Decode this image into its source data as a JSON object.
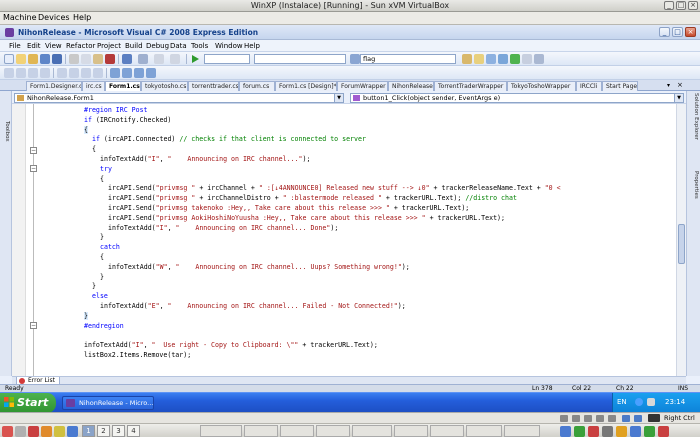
{
  "host": {
    "title": "WinXP (Instalace) [Running] - Sun xVM VirtualBox",
    "menu": [
      "Machine",
      "Devices",
      "Help"
    ],
    "hostkey": "Right Ctrl",
    "panel_numbers": [
      "2",
      "3",
      "4"
    ],
    "panel_active": "1"
  },
  "vs": {
    "title": "NihonRelease - Microsoft Visual C# 2008 Express Edition",
    "menu": [
      "File",
      "Edit",
      "View",
      "Refactor",
      "Project",
      "Build",
      "Debug",
      "Data",
      "Tools",
      "Window",
      "Help"
    ],
    "toolbar_search": "flag",
    "tabs": [
      "Form1.Designer.cs",
      "irc.cs",
      "Form1.cs*",
      "tokyotosho.cs",
      "torrenttrader.cs",
      "forum.cs",
      "Form1.cs [Design]*",
      "ForumWrapper",
      "NihonRelease",
      "TorrentTraderWrapper",
      "TokyoToshoWrapper",
      "IRCCli",
      "Start Page"
    ],
    "active_tab_index": 2,
    "class_combo": "NihonRelease.Form1",
    "member_combo": "button1_Click(object sender, EventArgs e)",
    "left_strip": "Toolbox",
    "right_strip_top": "Solution Explorer",
    "right_strip_bottom": "Properties",
    "error_list": "Error List",
    "status": {
      "ready": "Ready",
      "ln": "Ln 378",
      "col": "Col 22",
      "ch": "Ch 22",
      "ins": "INS"
    }
  },
  "code": [
    {
      "indent": 12,
      "parts": [
        {
          "t": "#region IRC Post",
          "c": "kw"
        }
      ]
    },
    {
      "indent": 12,
      "parts": [
        {
          "t": "if",
          "c": "kw"
        },
        {
          "t": " (IRCnotify.Checked)",
          "c": ""
        }
      ]
    },
    {
      "indent": 12,
      "parts": [
        {
          "t": "{",
          "c": "hl"
        }
      ]
    },
    {
      "indent": 14,
      "parts": [
        {
          "t": "if",
          "c": "kw"
        },
        {
          "t": " (ircAPI.Connected) ",
          "c": ""
        },
        {
          "t": "// checks if that client is connected to server",
          "c": "cm"
        }
      ]
    },
    {
      "indent": 14,
      "parts": [
        {
          "t": "{",
          "c": ""
        }
      ]
    },
    {
      "indent": 16,
      "parts": [
        {
          "t": "infoTextAdd(",
          "c": ""
        },
        {
          "t": "\"I\"",
          "c": "st"
        },
        {
          "t": ", ",
          "c": ""
        },
        {
          "t": "\"    Announcing on IRC channel...\"",
          "c": "st"
        },
        {
          "t": ");",
          "c": ""
        }
      ]
    },
    {
      "indent": 16,
      "parts": [
        {
          "t": "try",
          "c": "kw"
        }
      ]
    },
    {
      "indent": 16,
      "parts": [
        {
          "t": "{",
          "c": ""
        }
      ]
    },
    {
      "indent": 18,
      "parts": [
        {
          "t": "ircAPI.Send(",
          "c": ""
        },
        {
          "t": "\"privmsg \"",
          "c": "st"
        },
        {
          "t": " + ircChannel + ",
          "c": ""
        },
        {
          "t": "\" :[↓4ANNOUNCE0] Released new stuff --> ↓0\"",
          "c": "st"
        },
        {
          "t": " + trackerReleaseName.Text + ",
          "c": ""
        },
        {
          "t": "\"0 <",
          "c": "st"
        }
      ]
    },
    {
      "indent": 18,
      "parts": [
        {
          "t": "ircAPI.Send(",
          "c": ""
        },
        {
          "t": "\"privmsg \"",
          "c": "st"
        },
        {
          "t": " + ircChannelDistro + ",
          "c": ""
        },
        {
          "t": "\" :blastermode released \"",
          "c": "st"
        },
        {
          "t": " + trackerURL.Text); ",
          "c": ""
        },
        {
          "t": "//distro chat",
          "c": "cm"
        }
      ]
    },
    {
      "indent": 18,
      "parts": [
        {
          "t": "ircAPI.Send(",
          "c": ""
        },
        {
          "t": "\"privmsg takenoko :Hey,, Take care about this release >>> \"",
          "c": "st"
        },
        {
          "t": " + trackerURL.Text);",
          "c": ""
        }
      ]
    },
    {
      "indent": 18,
      "parts": [
        {
          "t": "ircAPI.Send(",
          "c": ""
        },
        {
          "t": "\"privmsg AokiHoshiNoYuusha :Hey,, Take care about this release >>> \"",
          "c": "st"
        },
        {
          "t": " + trackerURL.Text);",
          "c": ""
        }
      ]
    },
    {
      "indent": 18,
      "parts": [
        {
          "t": "infoTextAdd(",
          "c": ""
        },
        {
          "t": "\"I\"",
          "c": "st"
        },
        {
          "t": ", ",
          "c": ""
        },
        {
          "t": "\"    Announcing on IRC channel... Done\"",
          "c": "st"
        },
        {
          "t": ");",
          "c": ""
        }
      ]
    },
    {
      "indent": 16,
      "parts": [
        {
          "t": "}",
          "c": ""
        }
      ]
    },
    {
      "indent": 16,
      "parts": [
        {
          "t": "catch",
          "c": "kw"
        }
      ]
    },
    {
      "indent": 16,
      "parts": [
        {
          "t": "{",
          "c": ""
        }
      ]
    },
    {
      "indent": 18,
      "parts": [
        {
          "t": "infoTextAdd(",
          "c": ""
        },
        {
          "t": "\"W\"",
          "c": "st"
        },
        {
          "t": ", ",
          "c": ""
        },
        {
          "t": "\"    Announcing on IRC channel... Uups? Something wrong!\"",
          "c": "st"
        },
        {
          "t": ");",
          "c": ""
        }
      ]
    },
    {
      "indent": 16,
      "parts": [
        {
          "t": "}",
          "c": ""
        }
      ]
    },
    {
      "indent": 14,
      "parts": [
        {
          "t": "}",
          "c": ""
        }
      ]
    },
    {
      "indent": 14,
      "parts": [
        {
          "t": "else",
          "c": "kw"
        }
      ]
    },
    {
      "indent": 16,
      "parts": [
        {
          "t": "infoTextAdd(",
          "c": ""
        },
        {
          "t": "\"E\"",
          "c": "st"
        },
        {
          "t": ", ",
          "c": ""
        },
        {
          "t": "\"    Announcing on IRC channel... Failed - Not Connected!\"",
          "c": "st"
        },
        {
          "t": ");",
          "c": ""
        }
      ]
    },
    {
      "indent": 12,
      "parts": [
        {
          "t": "}",
          "c": "hl"
        }
      ]
    },
    {
      "indent": 12,
      "parts": [
        {
          "t": "#endregion",
          "c": "kw"
        }
      ]
    },
    {
      "indent": 12,
      "parts": [
        {
          "t": "",
          "c": ""
        }
      ]
    },
    {
      "indent": 12,
      "parts": [
        {
          "t": "infoTextAdd(",
          "c": ""
        },
        {
          "t": "\"I\"",
          "c": "st"
        },
        {
          "t": ", ",
          "c": ""
        },
        {
          "t": "\"  Use right - Copy to Clipboard: \\\"\"",
          "c": "st"
        },
        {
          "t": " + trackerURL.Text);",
          "c": ""
        }
      ]
    },
    {
      "indent": 12,
      "parts": [
        {
          "t": "listBox2.Items.Remove(tar);",
          "c": ""
        }
      ]
    }
  ],
  "taskbar": {
    "start": "Start",
    "item": "NihonRelease - Micro...",
    "lang": "EN",
    "time": "23:14"
  }
}
